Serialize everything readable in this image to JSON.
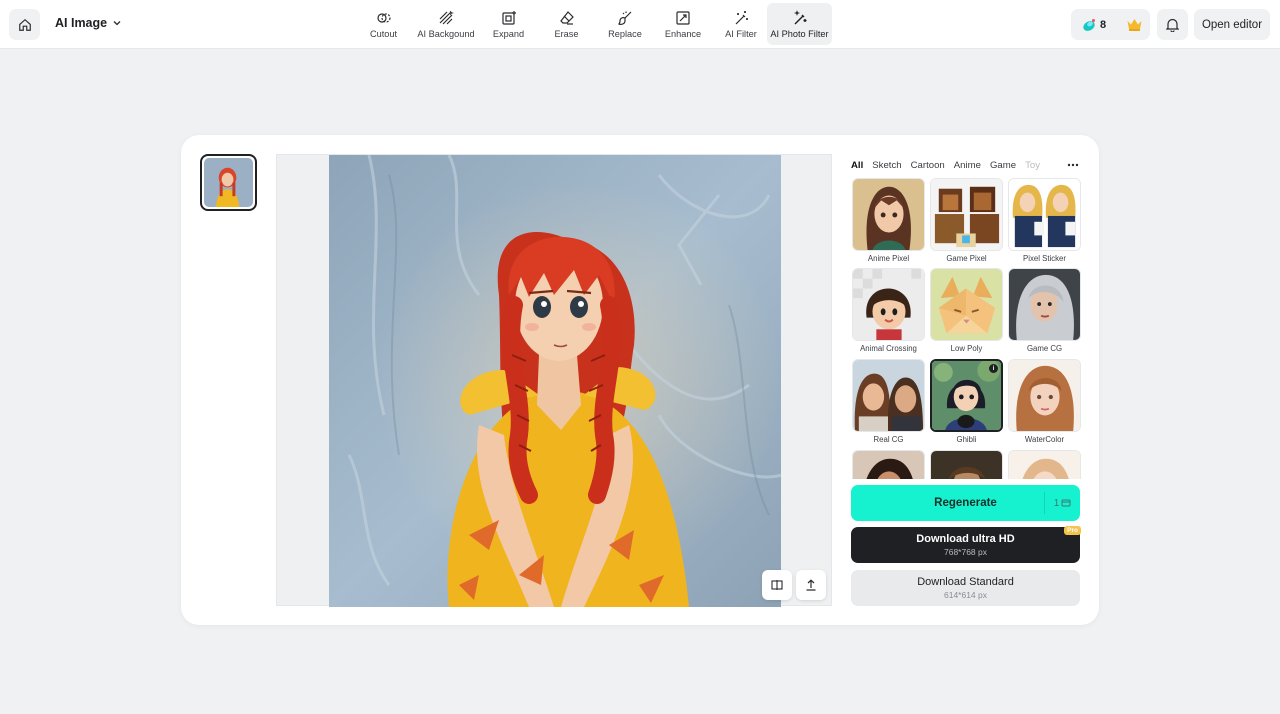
{
  "header": {
    "app_title": "AI Image",
    "credits": "8",
    "open_editor_label": "Open editor"
  },
  "tools": [
    {
      "label": "Cutout",
      "icon": "cutout-icon"
    },
    {
      "label": "AI Backgound",
      "icon": "ai-background-icon"
    },
    {
      "label": "Expand",
      "icon": "expand-icon"
    },
    {
      "label": "Erase",
      "icon": "eraser-icon"
    },
    {
      "label": "Replace",
      "icon": "brush-icon"
    },
    {
      "label": "Enhance",
      "icon": "enhance-icon"
    },
    {
      "label": "AI Filter",
      "icon": "magic-wand-icon"
    },
    {
      "label": "AI Photo Filter",
      "icon": "magic-wand-sparkle-icon",
      "active": true
    }
  ],
  "filter_panel": {
    "categories": [
      "All",
      "Sketch",
      "Cartoon",
      "Anime",
      "Game",
      "Toy"
    ],
    "active_category": "All",
    "filters": [
      {
        "label": "Anime Pixel"
      },
      {
        "label": "Game Pixel"
      },
      {
        "label": "Pixel Sticker"
      },
      {
        "label": "Animal Crossing"
      },
      {
        "label": "Low Poly"
      },
      {
        "label": "Game CG"
      },
      {
        "label": "Real CG"
      },
      {
        "label": "Ghibli",
        "selected": true
      },
      {
        "label": "WaterColor"
      }
    ]
  },
  "actions": {
    "regenerate_label": "Regenerate",
    "regenerate_cost": "1",
    "download_hd_label": "Download ultra HD",
    "download_hd_size": "768*768 px",
    "pro_badge": "Pro",
    "download_std_label": "Download Standard",
    "download_std_size": "614*614 px"
  },
  "colors": {
    "accent": "#16f2d0",
    "dark_button": "#1f2023",
    "pro_badge": "#f5c24a"
  }
}
